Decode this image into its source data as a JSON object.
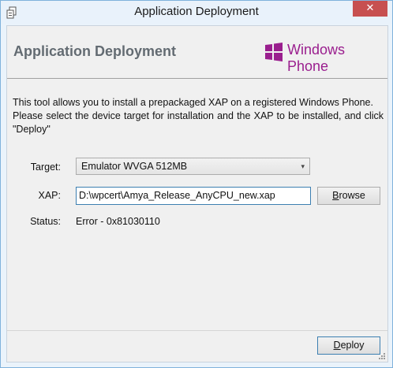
{
  "window": {
    "title": "Application Deployment",
    "close_label": "✕"
  },
  "header": {
    "title": "Application Deployment",
    "brand": "Windows Phone"
  },
  "description": {
    "line1": "This tool allows you to install a prepackaged XAP on a registered Windows Phone.",
    "line2": "Please select the device target for installation and the XAP to be installed, and click \"Deploy\""
  },
  "form": {
    "target_label": "Target:",
    "target_value": "Emulator WVGA 512MB",
    "xap_label": "XAP:",
    "xap_value": "D:\\wpcert\\Amya_Release_AnyCPU_new.xap",
    "browse_first": "B",
    "browse_rest": "rowse",
    "status_label": "Status:",
    "status_value": "Error - 0x81030110"
  },
  "footer": {
    "deploy_first": "D",
    "deploy_rest": "eploy"
  },
  "colors": {
    "brand": "#9a1e8e",
    "close": "#c75050",
    "header_text": "#636b72"
  }
}
